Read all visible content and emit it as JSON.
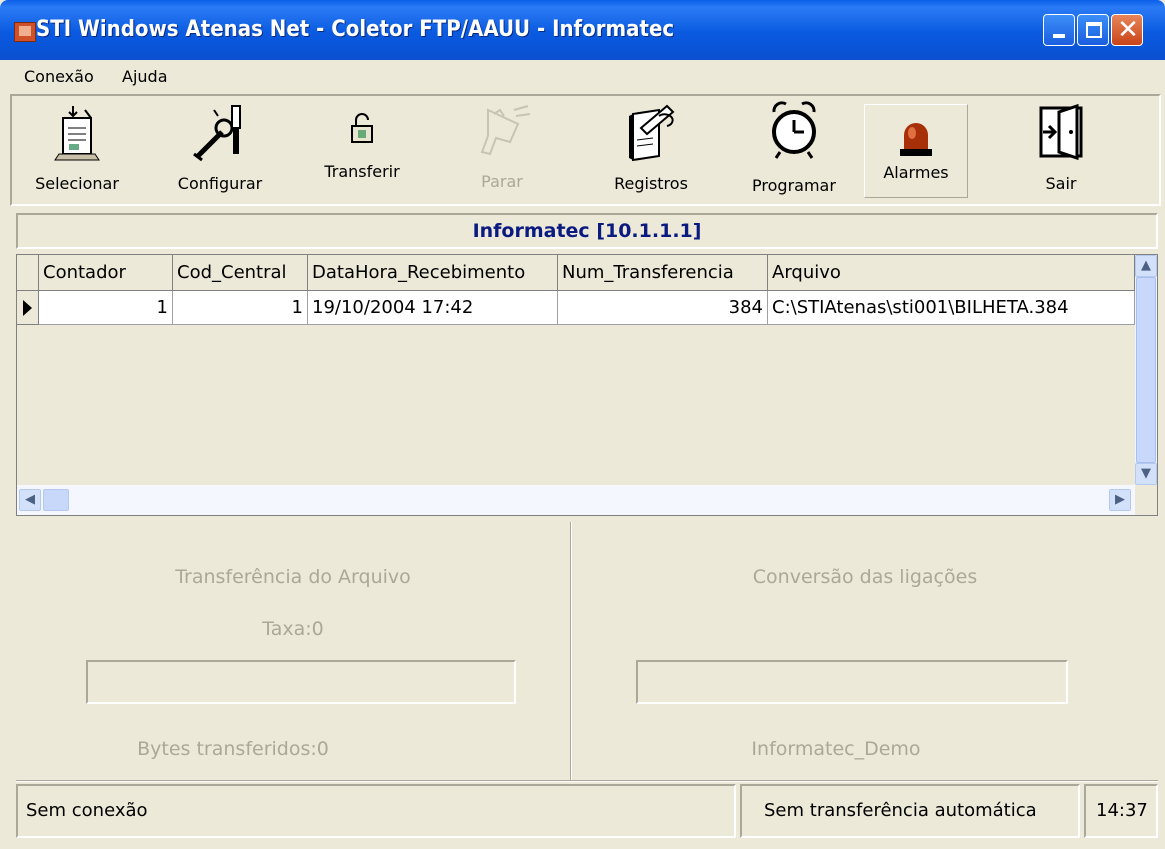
{
  "window": {
    "title": "STI Windows Atenas Net - Coletor FTP/AAUU - Informatec"
  },
  "menu": {
    "items": [
      "Conexão",
      "Ajuda"
    ]
  },
  "toolbar": {
    "buttons": [
      "Selecionar",
      "Configurar",
      "Transferir",
      "Parar",
      "Registros",
      "Programar",
      "Alarmes",
      "Sair"
    ],
    "disabled": [
      "Parar"
    ]
  },
  "connection": {
    "header": "Informatec [10.1.1.1]"
  },
  "grid": {
    "columns": [
      "Contador",
      "Cod_Central",
      "DataHora_Recebimento",
      "Num_Transferencia",
      "Arquivo"
    ],
    "rows": [
      [
        "1",
        "1",
        "19/10/2004 17:42",
        "384",
        "C:\\STIAtenas\\sti001\\BILHETA.384"
      ]
    ]
  },
  "transfer": {
    "title": "Transferência do Arquivo",
    "rate": "Taxa:0",
    "bytes": "Bytes transferidos:0",
    "progress": 0
  },
  "conversion": {
    "title": "Conversão das ligações",
    "name": "Informatec_Demo",
    "progress": 0
  },
  "status": {
    "connection": "Sem conexão",
    "auto_transfer": "Sem transferência automática",
    "time": "14:37"
  }
}
